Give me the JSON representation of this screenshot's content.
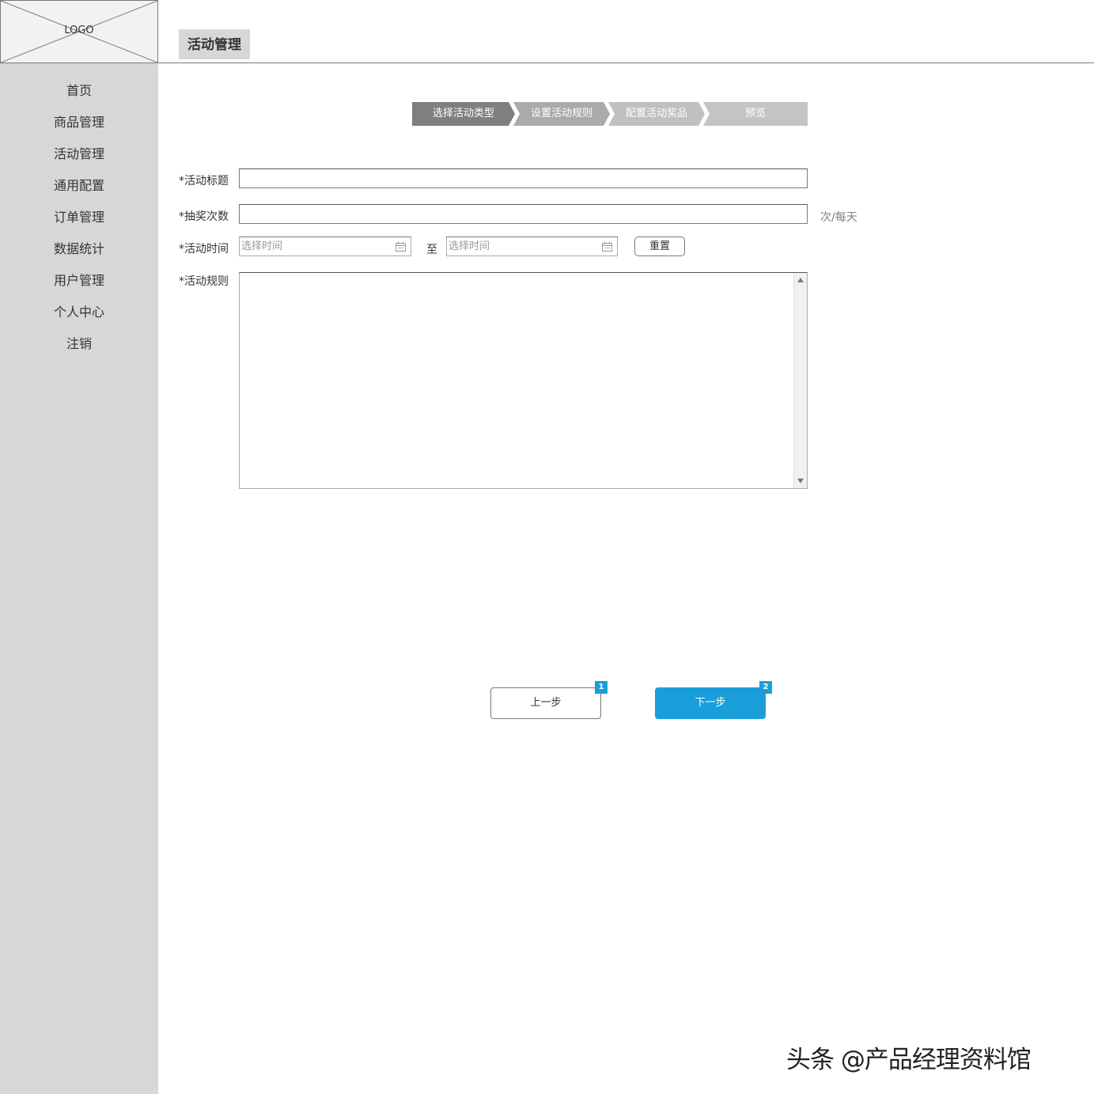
{
  "logo": {
    "text": "LOGO"
  },
  "sidebar": {
    "items": [
      {
        "label": "首页"
      },
      {
        "label": "商品管理"
      },
      {
        "label": "活动管理"
      },
      {
        "label": "通用配置"
      },
      {
        "label": "订单管理"
      },
      {
        "label": "数据统计"
      },
      {
        "label": "用户管理"
      },
      {
        "label": "个人中心"
      },
      {
        "label": "注销"
      }
    ]
  },
  "header": {
    "title": "活动管理"
  },
  "steps": [
    {
      "label": "选择活动类型"
    },
    {
      "label": "设置活动规则"
    },
    {
      "label": "配置活动奖品"
    },
    {
      "label": "预览"
    }
  ],
  "form": {
    "title_label": "*活动标题",
    "title_value": "",
    "draws_label": "*抽奖次数",
    "draws_value": "",
    "draws_unit": "次/每天",
    "time_label": "*活动时间",
    "start_placeholder": "选择时间",
    "to_label": "至",
    "end_placeholder": "选择时间",
    "reset_label": "重置",
    "rules_label": "*活动规则",
    "rules_value": ""
  },
  "actions": {
    "prev_label": "上一步",
    "prev_badge": "1",
    "next_label": "下一步",
    "next_badge": "2"
  },
  "watermark": "头条 @产品经理资料馆",
  "colors": {
    "sidebar_bg": "#d7d7d7",
    "accent": "#1a9ed9"
  }
}
